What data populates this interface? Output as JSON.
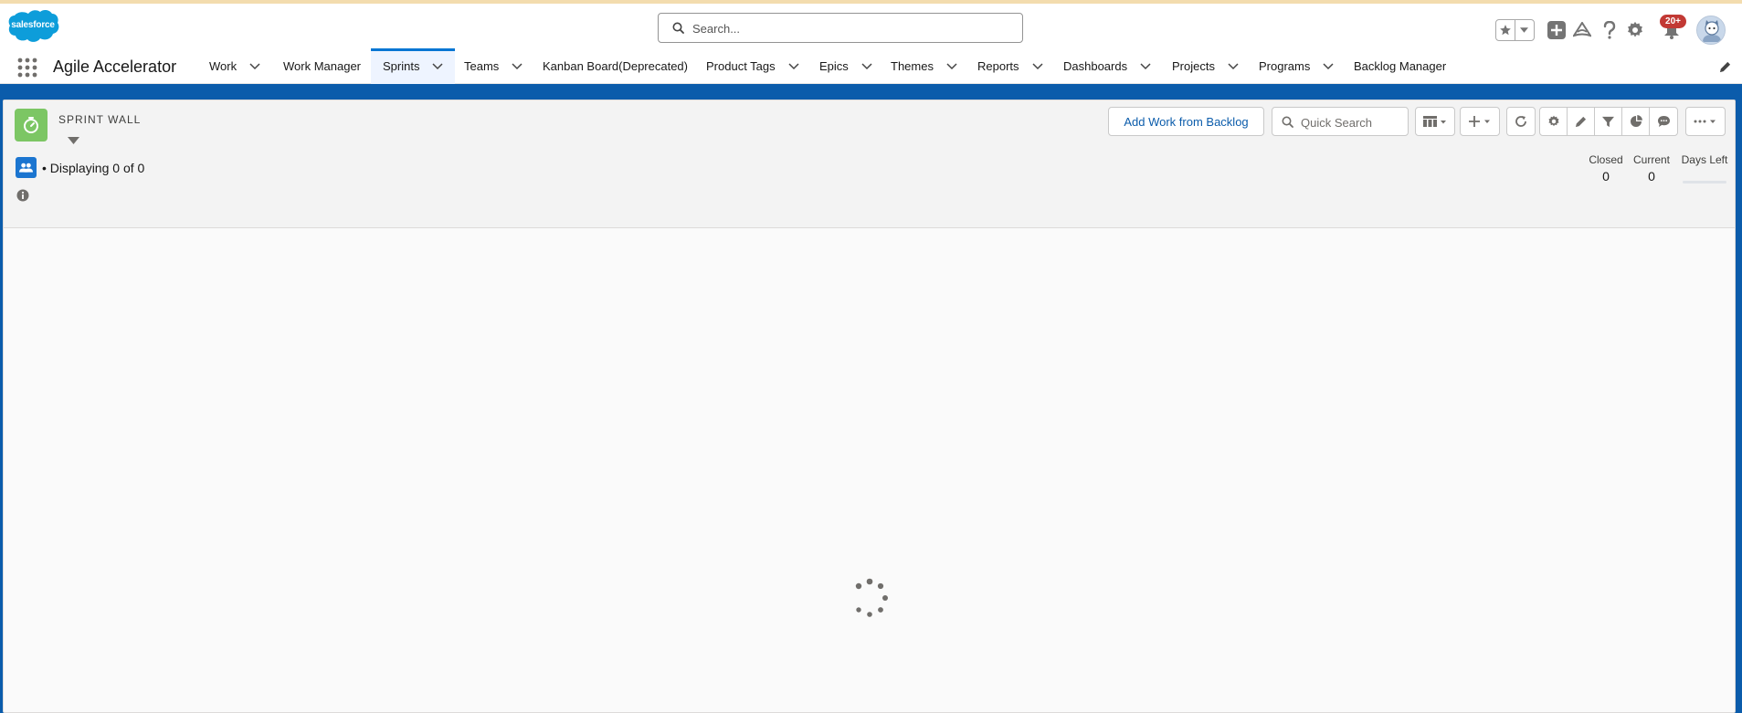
{
  "header": {
    "logo_text": "salesforce",
    "search_placeholder": "Search...",
    "notification_badge": "20+",
    "icons": [
      "favorites-star-icon",
      "favorites-dropdown-icon",
      "global-actions-add-icon",
      "trailhead-icon",
      "help-icon",
      "setup-gear-icon",
      "notifications-bell-icon",
      "user-avatar"
    ]
  },
  "nav": {
    "app_name": "Agile Accelerator",
    "tabs": [
      {
        "label": "Work",
        "has_menu": true
      },
      {
        "label": "Work Manager",
        "has_menu": false
      },
      {
        "label": "Sprints",
        "has_menu": true,
        "active": true
      },
      {
        "label": "Teams",
        "has_menu": true
      },
      {
        "label": "Kanban Board(Deprecated)",
        "has_menu": false
      },
      {
        "label": "Product Tags",
        "has_menu": true
      },
      {
        "label": "Epics",
        "has_menu": true
      },
      {
        "label": "Themes",
        "has_menu": true
      },
      {
        "label": "Reports",
        "has_menu": true
      },
      {
        "label": "Dashboards",
        "has_menu": true
      },
      {
        "label": "Projects",
        "has_menu": true
      },
      {
        "label": "Programs",
        "has_menu": true
      },
      {
        "label": "Backlog Manager",
        "has_menu": false
      }
    ]
  },
  "sprint_wall": {
    "object_label": "SPRINT WALL",
    "displaying": "• Displaying 0 of 0",
    "add_work_button": "Add Work from Backlog",
    "quick_search_placeholder": "Quick Search",
    "stats": {
      "closed_label": "Closed",
      "closed_value": "0",
      "current_label": "Current",
      "current_value": "0",
      "days_left_label": "Days Left"
    },
    "loading": true
  },
  "colors": {
    "brand_blue": "#0176d3",
    "band_blue": "#0b5cab",
    "sprint_icon_green": "#7cc664",
    "badge_red": "#c23934"
  }
}
